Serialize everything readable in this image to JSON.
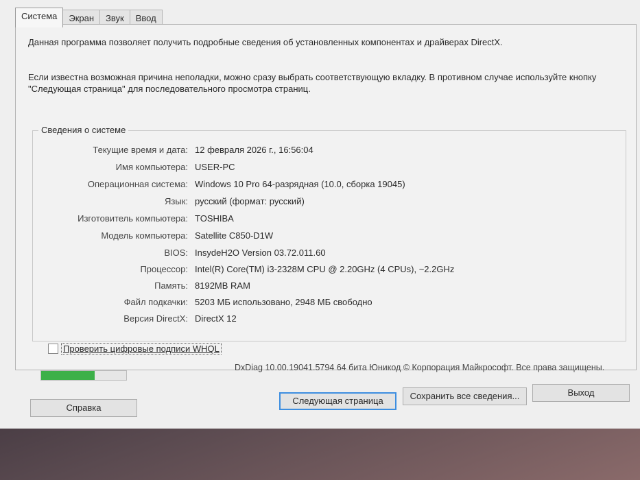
{
  "tabs": [
    {
      "label": "Система",
      "active": true
    },
    {
      "label": "Экран"
    },
    {
      "label": "Звук"
    },
    {
      "label": "Ввод"
    }
  ],
  "intro": {
    "line1": "Данная программа позволяет получить подробные сведения об установленных компонентах и драйверах DirectX.",
    "line2": "Если известна возможная причина неполадки, можно сразу выбрать соответствующую вкладку. В противном случае используйте кнопку \"Следующая страница\" для последовательного просмотра страниц."
  },
  "system_info": {
    "title": "Сведения о системе",
    "rows": [
      {
        "label": "Текущие время и дата:",
        "value": "12 февраля 2026 г., 16:56:04"
      },
      {
        "label": "Имя компьютера:",
        "value": "USER-PC"
      },
      {
        "label": "Операционная система:",
        "value": "Windows 10 Pro 64-разрядная (10.0, сборка 19045)"
      },
      {
        "label": "Язык:",
        "value": "русский (формат: русский)"
      },
      {
        "label": "Изготовитель компьютера:",
        "value": "TOSHIBA"
      },
      {
        "label": "Модель компьютера:",
        "value": "Satellite C850-D1W"
      },
      {
        "label": "BIOS:",
        "value": "InsydeH2O Version 03.72.011.60"
      },
      {
        "label": "Процессор:",
        "value": "Intel(R) Core(TM) i3-2328M CPU @ 2.20GHz (4 CPUs), ~2.2GHz"
      },
      {
        "label": "Память:",
        "value": "8192MB RAM"
      },
      {
        "label": "Файл подкачки:",
        "value": "5203 МБ использовано, 2948 МБ свободно"
      },
      {
        "label": "Версия DirectX:",
        "value": "DirectX 12"
      }
    ]
  },
  "whql": {
    "label": "Проверить цифровые подписи WHQL",
    "checked": false
  },
  "progress": {
    "fraction": 0.63,
    "color": "#3cb048"
  },
  "footer_info": "DxDiag 10.00.19041.5794 64 бита Юникод © Корпорация Майкрософт. Все права защищены.",
  "buttons": {
    "help": "Справка",
    "next": "Следующая страница",
    "save": "Сохранить все сведения...",
    "exit": "Выход"
  }
}
